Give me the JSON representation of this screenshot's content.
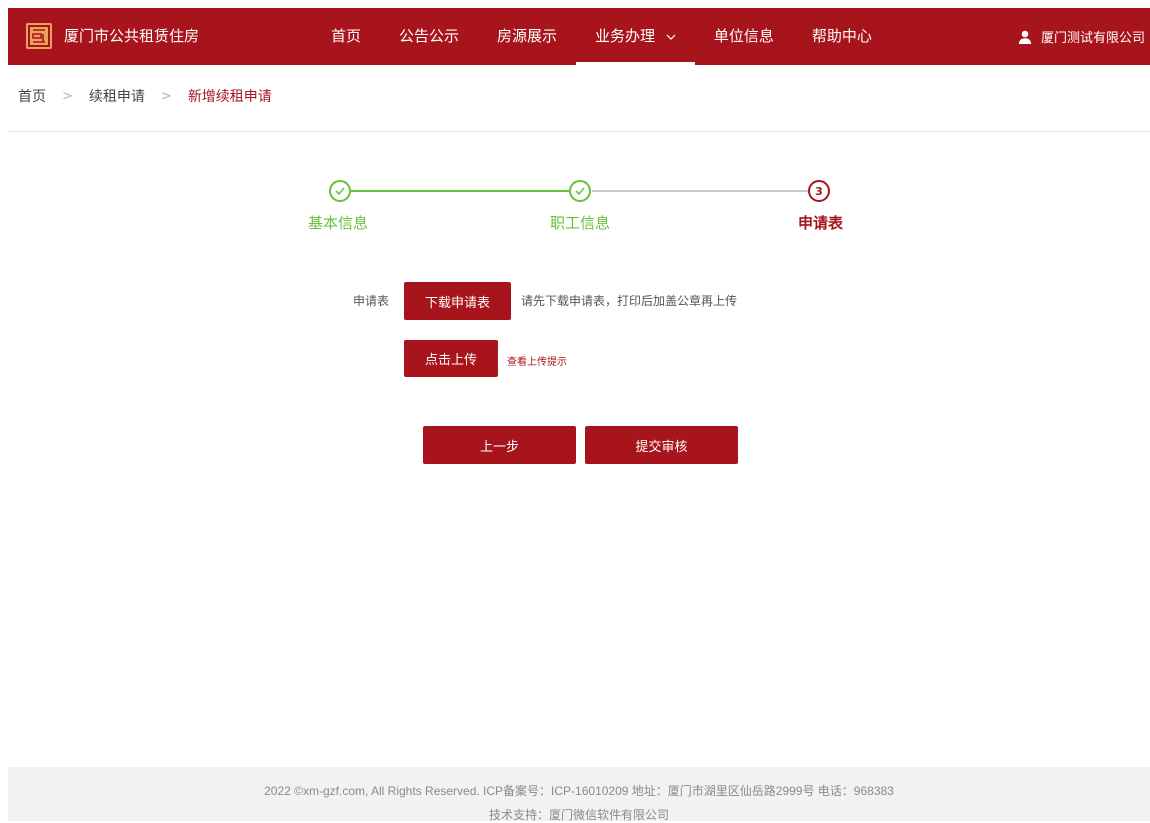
{
  "header": {
    "site_title": "厦门市公共租赁住房",
    "logo_icon": "site-logo-icon",
    "nav": [
      {
        "label": "首页"
      },
      {
        "label": "公告公示"
      },
      {
        "label": "房源展示"
      },
      {
        "label": "业务办理",
        "active": true,
        "has_dropdown": true
      },
      {
        "label": "单位信息"
      },
      {
        "label": "帮助中心"
      }
    ],
    "user_name": "厦门测试有限公司",
    "user_icon": "user-icon"
  },
  "breadcrumb": [
    "首页",
    "续租申请",
    "新增续租申请"
  ],
  "steps": [
    {
      "label": "基本信息",
      "status": "done"
    },
    {
      "label": "职工信息",
      "status": "done"
    },
    {
      "label": "申请表",
      "status": "current",
      "number": "3"
    }
  ],
  "form": {
    "field_label": "申请表",
    "download_button": "下载申请表",
    "hint": "请先下载申请表，打印后加盖公章再上传",
    "upload_button": "点击上传",
    "upload_tip": "查看上传提示"
  },
  "actions": {
    "prev": "上一步",
    "submit": "提交审核"
  },
  "footer": {
    "line1": "2022 ©xm-gzf.com, All Rights Reserved. ICP备案号：ICP-16010209 地址：厦门市湖里区仙岳路2999号 电话：968383",
    "line2": "技术支持：厦门微信软件有限公司"
  },
  "colors": {
    "brand": "#a8141c",
    "step_done": "#67c23a",
    "step_todo_line": "#c8c8cc"
  }
}
